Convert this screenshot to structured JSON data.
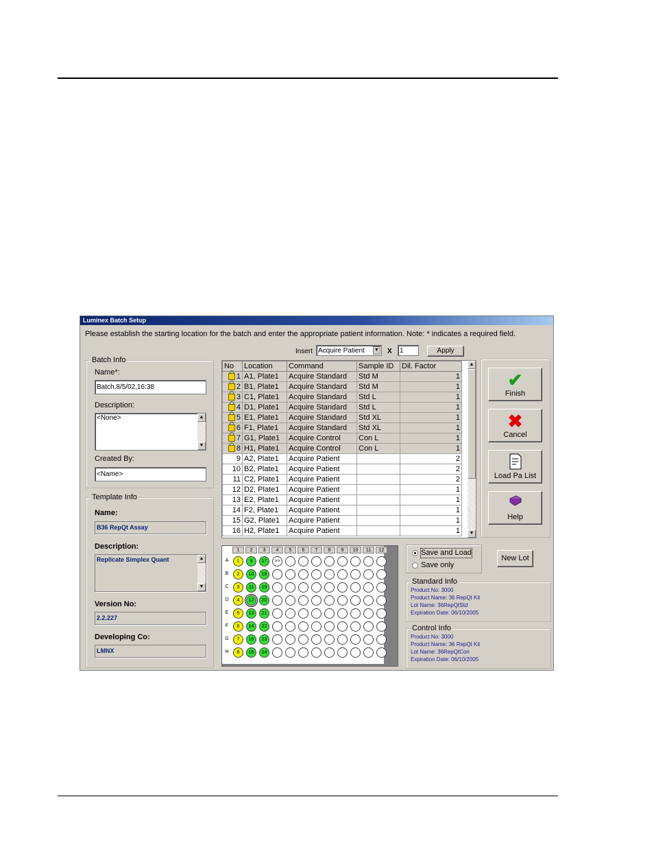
{
  "window": {
    "title": "Luminex Batch Setup",
    "instruction": "Please establish the starting location for the batch and enter the appropriate patient information.  Note: * indicates a required field."
  },
  "insert_bar": {
    "insert_label": "Insert",
    "command_value": "Acquire Patient",
    "x_label": "X",
    "count_value": "1",
    "apply_label": "Apply"
  },
  "batch_info": {
    "title": "Batch Info",
    "name_label": "Name*:",
    "name_value": "Batch,8/5/02,16:38",
    "description_label": "Description:",
    "description_value": "<None>",
    "created_by_label": "Created By:",
    "created_by_value": "<Name>"
  },
  "template_info": {
    "title": "Template Info",
    "name_label": "Name:",
    "name_value": "B36 RepQt Assay",
    "description_label": "Description:",
    "description_value": "Replicate Simplex Quant",
    "version_label": "Version No:",
    "version_value": "2.2.227",
    "developer_label": "Developing Co:",
    "developer_value": "LMNX"
  },
  "grid": {
    "headers": [
      "No",
      "Location",
      "Command",
      "Sample ID",
      "Dil. Factor"
    ],
    "rows": [
      {
        "no": "1",
        "location": "A1, Plate1",
        "command": "Acquire Standard",
        "sample": "Std M",
        "dil": "1",
        "locked": true
      },
      {
        "no": "2",
        "location": "B1, Plate1",
        "command": "Acquire Standard",
        "sample": "Std M",
        "dil": "1",
        "locked": true
      },
      {
        "no": "3",
        "location": "C1, Plate1",
        "command": "Acquire Standard",
        "sample": "Std L",
        "dil": "1",
        "locked": true
      },
      {
        "no": "4",
        "location": "D1, Plate1",
        "command": "Acquire Standard",
        "sample": "Std L",
        "dil": "1",
        "locked": true
      },
      {
        "no": "5",
        "location": "E1, Plate1",
        "command": "Acquire Standard",
        "sample": "Std XL",
        "dil": "1",
        "locked": true
      },
      {
        "no": "6",
        "location": "F1, Plate1",
        "command": "Acquire Standard",
        "sample": "Std XL",
        "dil": "1",
        "locked": true
      },
      {
        "no": "7",
        "location": "G1, Plate1",
        "command": "Acquire Control",
        "sample": "Con L",
        "dil": "1",
        "locked": true
      },
      {
        "no": "8",
        "location": "H1, Plate1",
        "command": "Acquire Control",
        "sample": "Con L",
        "dil": "1",
        "locked": true
      },
      {
        "no": "9",
        "location": "A2, Plate1",
        "command": "Acquire Patient",
        "sample": "",
        "dil": "2",
        "locked": false
      },
      {
        "no": "10",
        "location": "B2, Plate1",
        "command": "Acquire Patient",
        "sample": "",
        "dil": "2",
        "locked": false
      },
      {
        "no": "11",
        "location": "C2, Plate1",
        "command": "Acquire Patient",
        "sample": "",
        "dil": "2",
        "locked": false
      },
      {
        "no": "12",
        "location": "D2, Plate1",
        "command": "Acquire Patient",
        "sample": "",
        "dil": "1",
        "locked": false
      },
      {
        "no": "13",
        "location": "E2, Plate1",
        "command": "Acquire Patient",
        "sample": "",
        "dil": "1",
        "locked": false
      },
      {
        "no": "14",
        "location": "F2, Plate1",
        "command": "Acquire Patient",
        "sample": "",
        "dil": "1",
        "locked": false
      },
      {
        "no": "15",
        "location": "G2, Plate1",
        "command": "Acquire Patient",
        "sample": "",
        "dil": "1",
        "locked": false
      },
      {
        "no": "16",
        "location": "H2, Plate1",
        "command": "Acquire Patient",
        "sample": "",
        "dil": "1",
        "locked": false
      }
    ]
  },
  "side_buttons": {
    "finish": "Finish",
    "cancel": "Cancel",
    "load_list": "Load Pa List",
    "help": "Help"
  },
  "plate": {
    "columns": [
      "1",
      "2",
      "3",
      "4",
      "5",
      "6",
      "7",
      "8",
      "9",
      "10",
      "11",
      "12"
    ],
    "rows": [
      "A",
      "B",
      "C",
      "D",
      "E",
      "F",
      "G",
      "H"
    ],
    "col1": [
      "1",
      "2",
      "3",
      "4",
      "5",
      "6",
      "7",
      "8"
    ],
    "col2": [
      "9",
      "10",
      "11",
      "12",
      "13",
      "14",
      "15",
      "16"
    ],
    "col3": [
      "17",
      "18",
      "19",
      "20",
      "21",
      "22",
      "23",
      "24"
    ],
    "next_marker": ">>",
    "colors": {
      "standard": "#f2f200",
      "patient": "#33dd33",
      "empty": "#ffffff"
    }
  },
  "save_options": {
    "save_and_load": "Save and Load",
    "save_only": "Save only",
    "selected": "save_and_load",
    "new_lot_label": "New Lot"
  },
  "standard_info": {
    "title": "Standard Info",
    "product_no": "Product No: 3000",
    "product_name": "Product Name: 36 RepQt Kit",
    "lot_name": "Lot Name: 36RepQtStd",
    "expiration": "Expiration Date: 06/10/2005"
  },
  "control_info": {
    "title": "Control Info",
    "product_no": "Product No: 3000",
    "product_name": "Product Name: 36 RepQt Kit",
    "lot_name": "Lot Name: 36RepQtCon",
    "expiration": "Expiration Date: 06/10/2005"
  }
}
